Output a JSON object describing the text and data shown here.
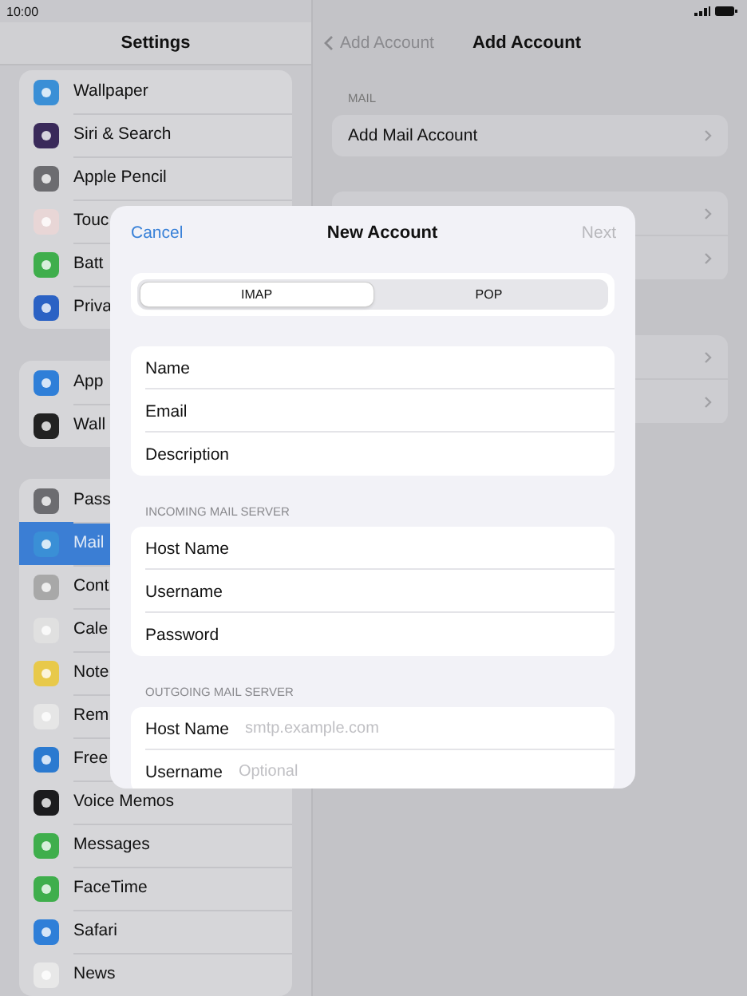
{
  "status_bar": {
    "time": "10:00"
  },
  "sidebar": {
    "title": "Settings",
    "groups": [
      [
        {
          "label": "Wallpaper",
          "color": "#3a8fd6",
          "selected": false
        },
        {
          "label": "Siri & Search",
          "color": "#3a2a5a",
          "selected": false
        },
        {
          "label": "Apple Pencil",
          "color": "#6c6c70",
          "selected": false
        },
        {
          "label": "Touc",
          "color": "#e8d6d6",
          "selected": false
        },
        {
          "label": "Batt",
          "color": "#3fae4c",
          "selected": false
        },
        {
          "label": "Priva",
          "color": "#2b62c4",
          "selected": false
        }
      ],
      [
        {
          "label": "App",
          "color": "#2f7fd8",
          "selected": false
        },
        {
          "label": "Wall",
          "color": "#222222",
          "selected": false
        }
      ],
      [
        {
          "label": "Pass",
          "color": "#6c6c70",
          "selected": false
        },
        {
          "label": "Mail",
          "color": "#3a8fd6",
          "selected": true
        },
        {
          "label": "Cont",
          "color": "#a8a8a8",
          "selected": false
        },
        {
          "label": "Cale",
          "color": "#e0e0e0",
          "selected": false
        },
        {
          "label": "Note",
          "color": "#e8c94a",
          "selected": false
        },
        {
          "label": "Rem",
          "color": "#e6e6e6",
          "selected": false
        },
        {
          "label": "Free",
          "color": "#2b7ad0",
          "selected": false
        },
        {
          "label": "Voice Memos",
          "color": "#1c1c1e",
          "selected": false
        },
        {
          "label": "Messages",
          "color": "#3fae4c",
          "selected": false
        },
        {
          "label": "FaceTime",
          "color": "#3fae4c",
          "selected": false
        },
        {
          "label": "Safari",
          "color": "#2f7fd8",
          "selected": false
        },
        {
          "label": "News",
          "color": "#e8e8e8",
          "selected": false
        }
      ]
    ]
  },
  "detail": {
    "back": "Add Account",
    "title": "Add Account",
    "section": "MAIL",
    "row": "Add Mail Account"
  },
  "dialog": {
    "cancel": "Cancel",
    "title": "New Account",
    "next": "Next",
    "next_disabled": true,
    "segments": [
      {
        "label": "IMAP",
        "selected": true
      },
      {
        "label": "POP",
        "selected": false
      }
    ],
    "sections": [
      {
        "fields": [
          {
            "label": "Name"
          },
          {
            "label": "Email"
          },
          {
            "label": "Description"
          }
        ]
      },
      {
        "header": "INCOMING MAIL SERVER",
        "fields": [
          {
            "label": "Host Name"
          },
          {
            "label": "Username"
          },
          {
            "label": "Password"
          }
        ]
      },
      {
        "header": "OUTGOING MAIL SERVER",
        "fields": [
          {
            "label": "Host Name",
            "placeholder": "smtp.example.com"
          },
          {
            "label": "Username",
            "placeholder": "Optional"
          }
        ]
      }
    ]
  }
}
